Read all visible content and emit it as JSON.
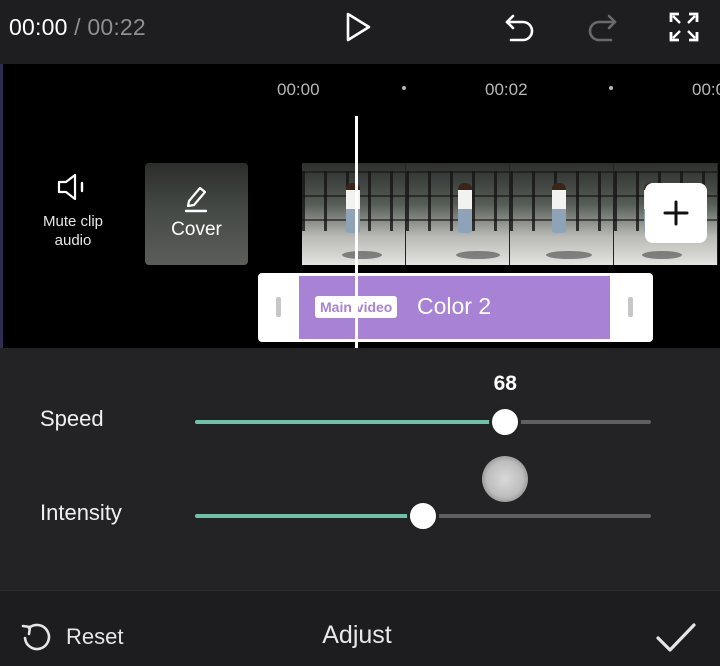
{
  "player": {
    "current_time": "00:00",
    "separator": "/",
    "duration": "00:22",
    "icons": [
      "play-icon",
      "undo-icon",
      "redo-icon",
      "fullscreen-icon"
    ]
  },
  "timeline": {
    "ruler": [
      "00:00",
      "00:02",
      "00:0"
    ],
    "mute_label": "Mute clip audio",
    "cover_label": "Cover",
    "clip": {
      "badge": "Main video",
      "name": "Color 2",
      "color": "#a882d4"
    }
  },
  "adjust": {
    "accent_color": "#6fc1a9",
    "sliders": [
      {
        "label": "Speed",
        "value": 68,
        "fraction": 0.68,
        "show_value": true
      },
      {
        "label": "Intensity",
        "value": 50,
        "fraction": 0.5,
        "show_value": false
      }
    ]
  },
  "bottom": {
    "reset_label": "Reset",
    "title": "Adjust",
    "confirm_icon": "checkmark-icon"
  }
}
